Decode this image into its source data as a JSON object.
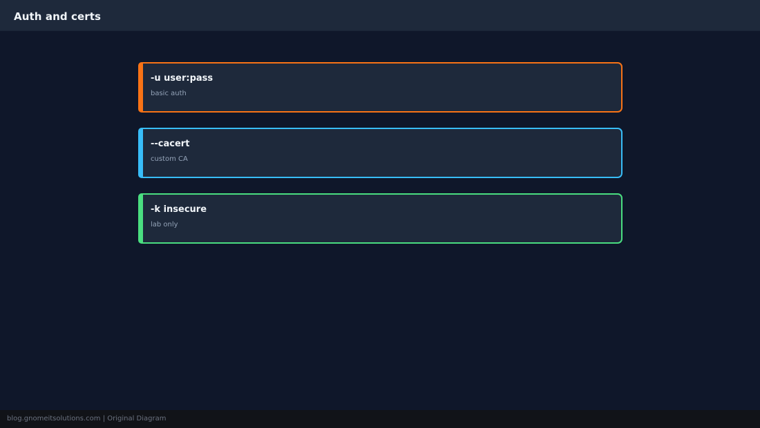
{
  "header": {
    "title": "Auth and certs"
  },
  "cards": [
    {
      "title": "-u user:pass",
      "subtitle": "basic auth",
      "color": "#f97316"
    },
    {
      "title": "--cacert",
      "subtitle": "custom CA",
      "color": "#38bdf8"
    },
    {
      "title": "-k insecure",
      "subtitle": "lab only",
      "color": "#4ade80"
    }
  ],
  "footer": {
    "text": "blog.gnomeitsolutions.com | Original Diagram"
  }
}
